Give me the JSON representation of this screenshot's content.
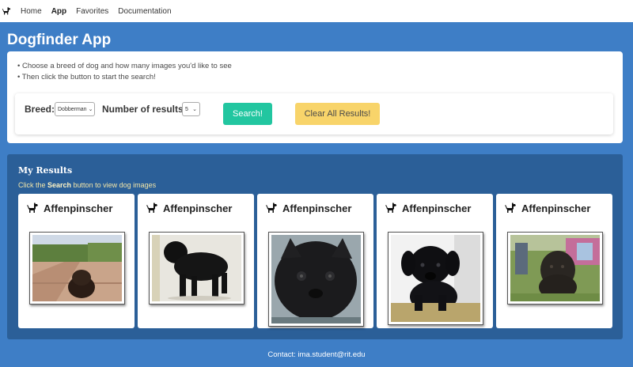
{
  "nav": {
    "logo_icon": "dog-icon",
    "links": [
      "Home",
      "App",
      "Favorites",
      "Documentation"
    ],
    "active": "App"
  },
  "app": {
    "title": "Dogfinder App",
    "instructions": [
      "• Choose a breed of dog and how many images you'd like to see",
      "• Then click the button to start the search!"
    ]
  },
  "form": {
    "breed_label": "Breed:",
    "breed_value": "Dobberman",
    "count_label": "Number of results:",
    "count_value": "5",
    "search_label": "Search!",
    "clear_label": "Clear All Results!"
  },
  "results": {
    "title": "My Results",
    "hint_prefix": "Click the ",
    "hint_bold": "Search",
    "hint_suffix": " button to view dog images",
    "cards": [
      {
        "breed": "Affenpinscher"
      },
      {
        "breed": "Affenpinscher"
      },
      {
        "breed": "Affenpinscher"
      },
      {
        "breed": "Affenpinscher"
      },
      {
        "breed": "Affenpinscher"
      }
    ]
  },
  "footer": {
    "contact": "Contact: ima.student@rit.edu"
  },
  "colors": {
    "accent": "#3e7ec6",
    "results_bg": "#2b5f98",
    "search_button": "#22c6a0",
    "clear_button": "#f8d46a"
  }
}
